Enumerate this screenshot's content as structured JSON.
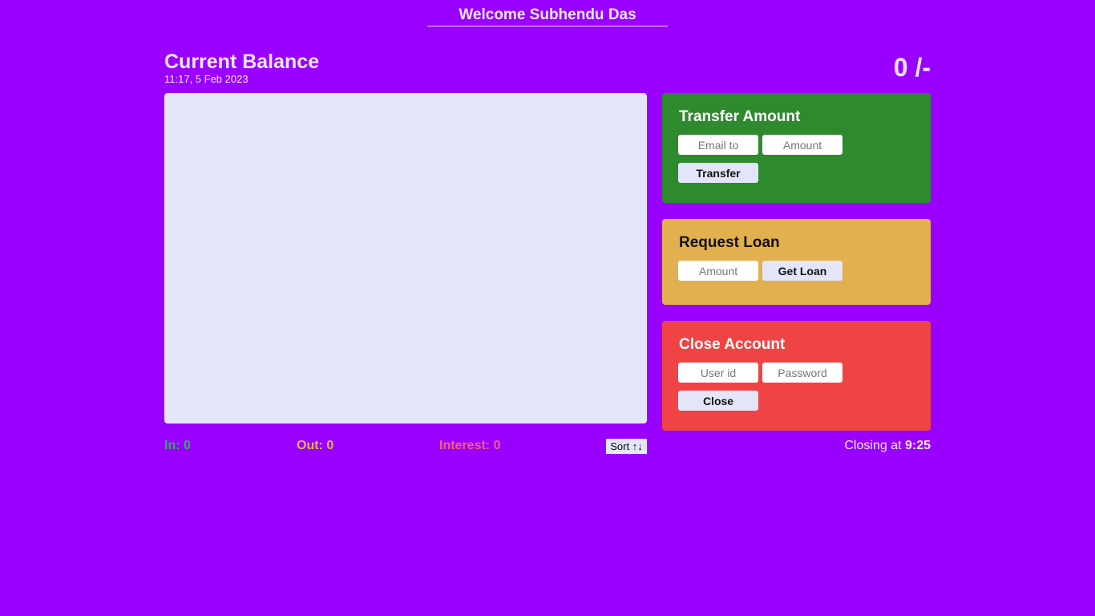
{
  "header": {
    "welcome": "Welcome Subhendu Das"
  },
  "balance": {
    "title": "Current Balance",
    "date": "11:17, 5 Feb 2023",
    "value": "0 /-"
  },
  "transfer": {
    "title": "Transfer Amount",
    "email_placeholder": "Email to",
    "amount_placeholder": "Amount",
    "button_label": "Transfer",
    "color": "#2d8a2d"
  },
  "loan": {
    "title": "Request Loan",
    "amount_placeholder": "Amount",
    "button_label": "Get Loan",
    "color": "#e2b04e"
  },
  "close": {
    "title": "Close Account",
    "user_placeholder": "User id",
    "password_placeholder": "Password",
    "button_label": "Close",
    "color": "#f04444"
  },
  "summary": {
    "in": "In: 0",
    "out": "Out: 0",
    "interest": "Interest: 0",
    "sort_label": "Sort ↑↓",
    "closing_prefix": "Closing at ",
    "closing_time": "9:25"
  },
  "theme": {
    "background": "#9900ff",
    "panel": "#e3e6f8"
  }
}
